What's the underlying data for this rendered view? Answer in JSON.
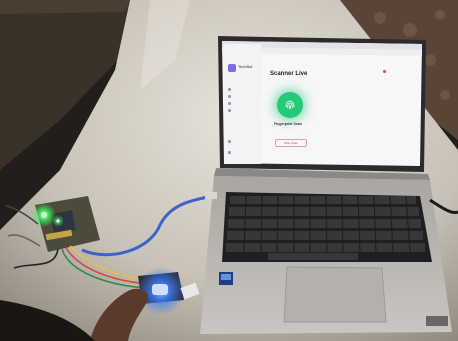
{
  "photo": {
    "colors": {
      "wall": "#2a2622",
      "table": "#cfc9be",
      "laptop_body": "#c2bfba",
      "screen_bg": "#f7f6f8",
      "sensor_glow": "#3d7dff",
      "led_green": "#39ff5a",
      "cable": "#3c63c9"
    },
    "objects": [
      "laptop",
      "fingerprint-sensor",
      "microcontroller-board",
      "usb-cable",
      "hand"
    ]
  },
  "screen": {
    "brand": "TechBot",
    "title": "Scanner Live",
    "scan_label": "Fingerprint Scan",
    "stop_label": "Stop Scan"
  }
}
